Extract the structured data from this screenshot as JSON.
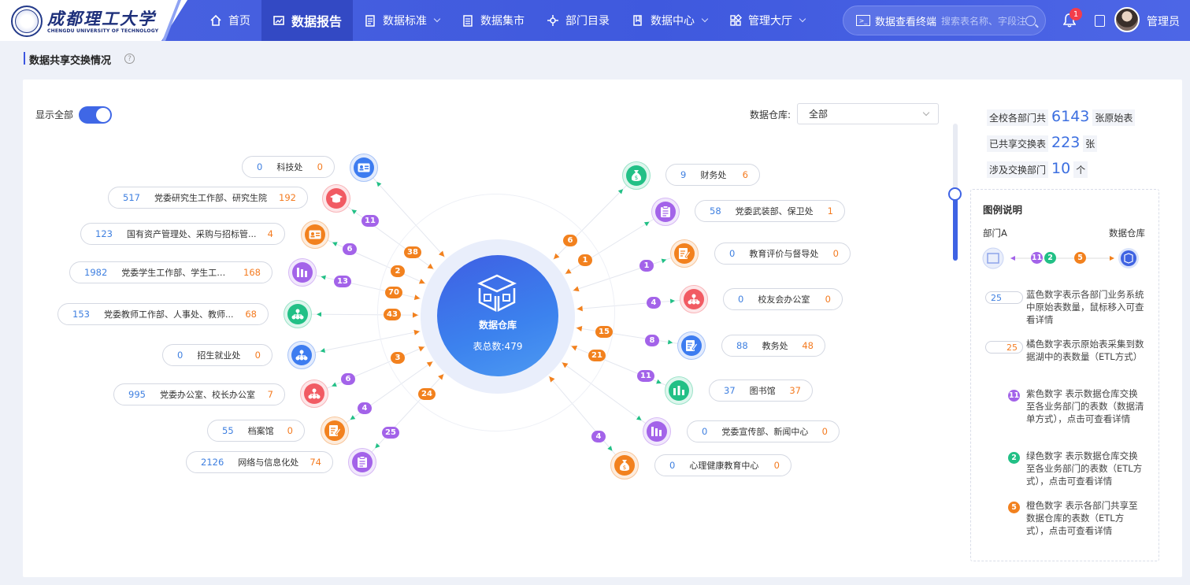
{
  "header": {
    "logo_title": "成都理工大学",
    "logo_subtitle": "CHENGDU UNIVERSITY OF TECHNOLOGY",
    "nav": [
      {
        "label": "首页",
        "icon": "home-icon",
        "active": false,
        "dropdown": false
      },
      {
        "label": "数据报告",
        "icon": "chart-icon",
        "active": true,
        "dropdown": false
      },
      {
        "label": "数据标准",
        "icon": "clipboard-icon",
        "active": false,
        "dropdown": true
      },
      {
        "label": "数据集市",
        "icon": "document-icon",
        "active": false,
        "dropdown": false
      },
      {
        "label": "部门目录",
        "icon": "network-icon",
        "active": false,
        "dropdown": false
      },
      {
        "label": "数据中心",
        "icon": "book-icon",
        "active": false,
        "dropdown": true
      },
      {
        "label": "管理大厅",
        "icon": "grid-icon",
        "active": false,
        "dropdown": true
      }
    ],
    "search_tag": "数据查看终端",
    "search_placeholder": "搜索表名称、字段注释",
    "notification_count": "1",
    "user": "管理员"
  },
  "page": {
    "title": "数据共享交换情况",
    "toggle_label": "显示全部",
    "select_label": "数据仓库:",
    "select_value": "全部"
  },
  "center": {
    "title": "数据仓库",
    "total": "表总数:479"
  },
  "left_departments": [
    {
      "name": "科技处",
      "blue": "0",
      "orange": "0",
      "icon": "id-card-icon",
      "color": "#3d7cf0",
      "badges": [
        {
          "v": "38",
          "c": "orange"
        }
      ]
    },
    {
      "name": "党委研究生工作部、研究生院",
      "blue": "517",
      "orange": "192",
      "icon": "graduation-cap-icon",
      "color": "#f15b63",
      "badges": [
        {
          "v": "11",
          "c": "purple"
        },
        {
          "v": "2",
          "c": "orange"
        }
      ]
    },
    {
      "name": "国有资产管理处、采购与招标管...",
      "blue": "123",
      "orange": "4",
      "icon": "id-card-icon",
      "color": "#f2811e",
      "badges": [
        {
          "v": "6",
          "c": "purple"
        },
        {
          "v": "70",
          "c": "orange"
        }
      ]
    },
    {
      "name": "党委学生工作部、学生工作处",
      "blue": "1982",
      "orange": "168",
      "icon": "books-icon",
      "color": "#a363e9",
      "badges": [
        {
          "v": "13",
          "c": "purple"
        }
      ]
    },
    {
      "name": "党委教师工作部、人事处、教师...",
      "blue": "153",
      "orange": "68",
      "icon": "org-chart-icon",
      "color": "#22c086",
      "badges": [
        {
          "v": "43",
          "c": "orange"
        }
      ]
    },
    {
      "name": "招生就业处",
      "blue": "0",
      "orange": "0",
      "icon": "org-chart-icon",
      "color": "#3d7cf0",
      "badges": [
        {
          "v": "3",
          "c": "orange"
        }
      ]
    },
    {
      "name": "党委办公室、校长办公室",
      "blue": "995",
      "orange": "7",
      "icon": "org-chart-icon",
      "color": "#f15b63",
      "badges": [
        {
          "v": "6",
          "c": "purple"
        },
        {
          "v": "24",
          "c": "orange"
        }
      ]
    },
    {
      "name": "档案馆",
      "blue": "55",
      "orange": "0",
      "icon": "edit-doc-icon",
      "color": "#f2811e",
      "badges": [
        {
          "v": "4",
          "c": "purple"
        }
      ]
    },
    {
      "name": "网络与信息化处",
      "blue": "2126",
      "orange": "74",
      "icon": "clipboard-icon",
      "color": "#a363e9",
      "badges": [
        {
          "v": "25",
          "c": "purple"
        }
      ]
    }
  ],
  "right_departments": [
    {
      "name": "财务处",
      "blue": "9",
      "orange": "6",
      "icon": "money-bag-icon",
      "color": "#22c086",
      "badges": [
        {
          "v": "6",
          "c": "orange"
        }
      ]
    },
    {
      "name": "党委武装部、保卫处",
      "blue": "58",
      "orange": "1",
      "icon": "clipboard-icon",
      "color": "#a363e9",
      "badges": [
        {
          "v": "1",
          "c": "orange"
        }
      ]
    },
    {
      "name": "教育评价与督导处",
      "blue": "0",
      "orange": "0",
      "icon": "edit-doc-icon",
      "color": "#f2811e",
      "badges": [
        {
          "v": "1",
          "c": "purple"
        }
      ]
    },
    {
      "name": "校友会办公室",
      "blue": "0",
      "orange": "0",
      "icon": "org-chart-icon",
      "color": "#f15b63",
      "badges": [
        {
          "v": "4",
          "c": "purple"
        }
      ]
    },
    {
      "name": "教务处",
      "blue": "88",
      "orange": "48",
      "icon": "edit-doc-icon",
      "color": "#3d7cf0",
      "badges": [
        {
          "v": "8",
          "c": "purple"
        },
        {
          "v": "15",
          "c": "orange"
        }
      ]
    },
    {
      "name": "图书馆",
      "blue": "37",
      "orange": "37",
      "icon": "bar-chart-icon",
      "color": "#22c086",
      "badges": [
        {
          "v": "11",
          "c": "purple"
        },
        {
          "v": "21",
          "c": "orange"
        }
      ]
    },
    {
      "name": "党委宣传部、新闻中心",
      "blue": "0",
      "orange": "0",
      "icon": "books-icon",
      "color": "#a363e9",
      "badges": []
    },
    {
      "name": "心理健康教育中心",
      "blue": "0",
      "orange": "0",
      "icon": "money-bag-icon",
      "color": "#f2811e",
      "badges": [
        {
          "v": "4",
          "c": "purple"
        }
      ]
    }
  ],
  "stats": {
    "s1_pre": "全校各部门共",
    "s1_num": "6143",
    "s1_post": "张原始表",
    "s2_pre": "已共享交换表",
    "s2_num": "223",
    "s2_post": "张",
    "s3_pre": "涉及交换部门",
    "s3_num": "10",
    "s3_post": "个"
  },
  "legend": {
    "title": "图例说明",
    "dept_a": "部门A",
    "warehouse": "数据仓库",
    "sample_purple": "11",
    "sample_green": "2",
    "sample_orange": "5",
    "pill_blue": "25",
    "pill_orange": "25",
    "items": [
      "蓝色数字表示各部门业务系统中原始表数量，鼠标移入可查看详情",
      "橘色数字表示原始表采集到数据湖中的表数量（ETL方式）",
      "紫色数字 表示数据仓库交换至各业务部门的表数（数据清单方式），点击可查看详情",
      "绿色数字 表示数据仓库交换至各业务部门的表数（ETL方式），点击可查看详情",
      "橙色数字 表示各部门共享至数据仓库的表数（ETL方式），点击可查看详情"
    ],
    "dots": [
      "11",
      "2",
      "5"
    ]
  },
  "colors": {
    "header": "#4a63e0",
    "accent": "#3c6fe0",
    "purple": "#a363e9",
    "green": "#22c086",
    "orange": "#f2811e"
  }
}
